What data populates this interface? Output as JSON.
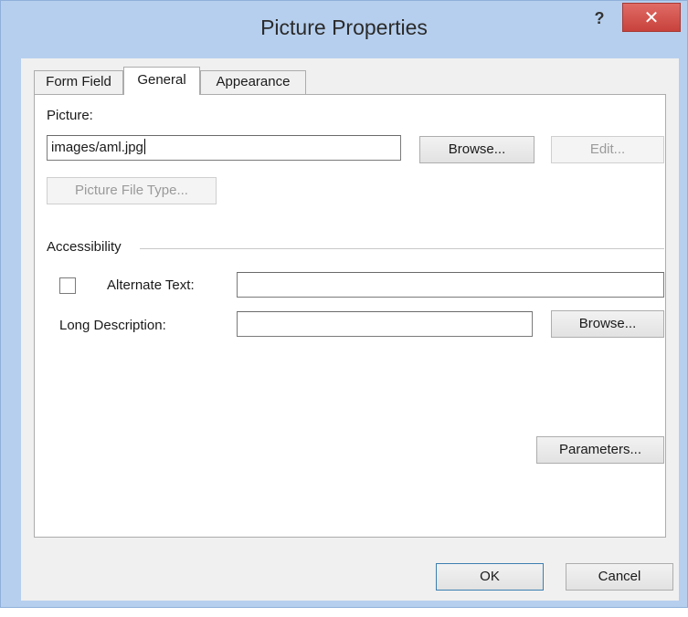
{
  "window": {
    "title": "Picture Properties",
    "help_label": "?",
    "close_label": "✕"
  },
  "tabs": [
    {
      "label": "Form Field",
      "active": false
    },
    {
      "label": "General",
      "active": true
    },
    {
      "label": "Appearance",
      "active": false
    }
  ],
  "general": {
    "picture_label": "Picture:",
    "picture_value": "images/aml.jpg",
    "browse_label": "Browse...",
    "edit_label": "Edit...",
    "picture_file_type_label": "Picture File Type...",
    "accessibility_label": "Accessibility",
    "alternate_text_label": "Alternate Text:",
    "alternate_text_value": "",
    "alternate_text_checked": false,
    "long_description_label": "Long Description:",
    "long_description_value": "",
    "long_description_browse_label": "Browse...",
    "parameters_label": "Parameters..."
  },
  "footer": {
    "ok_label": "OK",
    "cancel_label": "Cancel"
  },
  "colors": {
    "frame": "#b6cfee",
    "close_button": "#c8423c",
    "client_background": "#f0f0f0"
  }
}
